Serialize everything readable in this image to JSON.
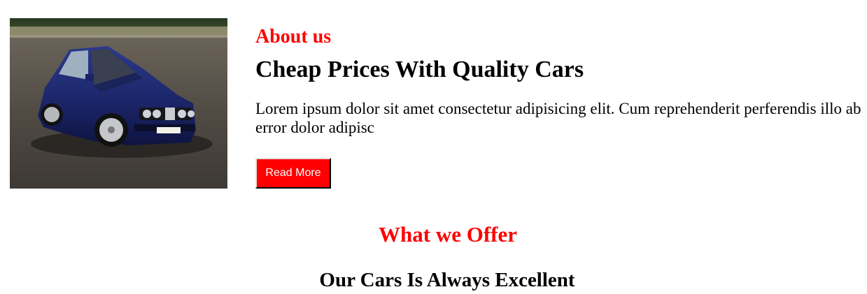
{
  "about": {
    "eyebrow": "About us",
    "headline": "Cheap Prices With Quality Cars",
    "body": "Lorem ipsum dolor sit amet consectetur adipisicing elit. Cum reprehenderit perferendis illo ab error dolor adipisc",
    "read_more_label": "Read More",
    "image_alt": "Blue BMW car"
  },
  "offer": {
    "title": "What we Offer",
    "subtitle": "Our Cars Is Always Excellent"
  },
  "colors": {
    "accent": "#ff0000",
    "button_bg": "#ff0000",
    "button_text": "#ffffff"
  }
}
